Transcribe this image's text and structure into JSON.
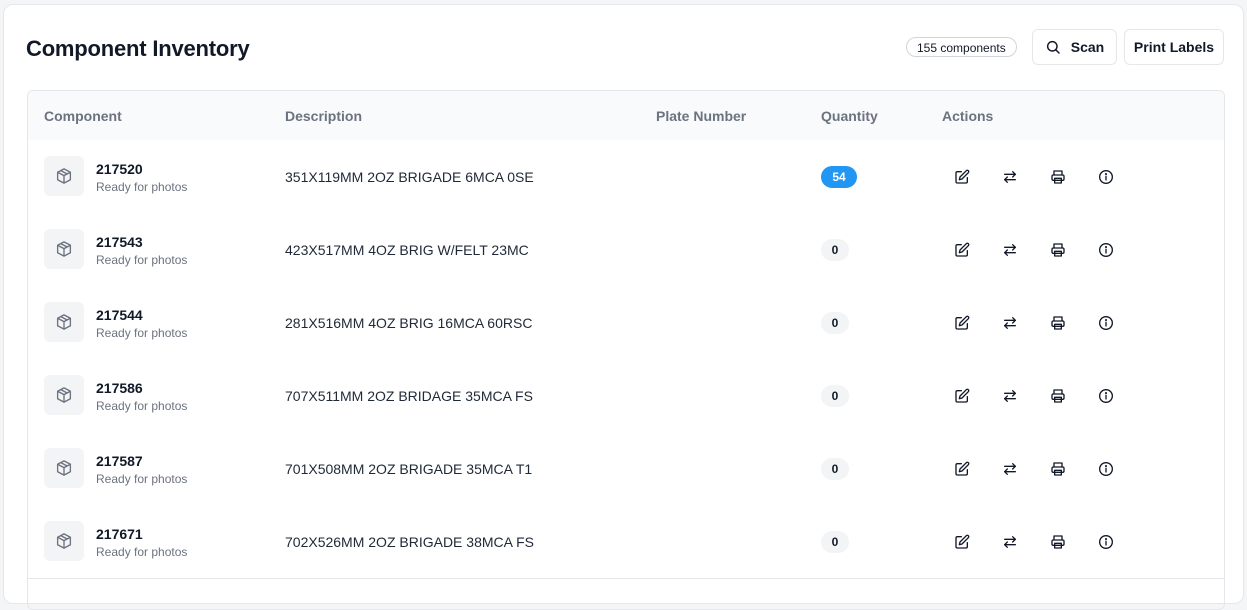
{
  "header": {
    "title": "Component Inventory",
    "count_label": "155 components",
    "scan_label": "Scan",
    "print_labels_label": "Print Labels"
  },
  "table": {
    "columns": [
      "Component",
      "Description",
      "Plate Number",
      "Quantity",
      "Actions"
    ],
    "rows": [
      {
        "id": "217520",
        "status": "Ready for photos",
        "description": "351X119MM 2OZ BRIGADE 6MCA 0SE",
        "plate": "",
        "quantity": "54"
      },
      {
        "id": "217543",
        "status": "Ready for photos",
        "description": "423X517MM 4OZ BRIG W/FELT 23MC",
        "plate": "",
        "quantity": "0"
      },
      {
        "id": "217544",
        "status": "Ready for photos",
        "description": "281X516MM 4OZ BRIG 16MCA 60RSC",
        "plate": "",
        "quantity": "0"
      },
      {
        "id": "217586",
        "status": "Ready for photos",
        "description": "707X511MM 2OZ BRIDAGE 35MCA FS",
        "plate": "",
        "quantity": "0"
      },
      {
        "id": "217587",
        "status": "Ready for photos",
        "description": "701X508MM 2OZ BRIGADE 35MCA T1",
        "plate": "",
        "quantity": "0"
      },
      {
        "id": "217671",
        "status": "Ready for photos",
        "description": "702X526MM 2OZ BRIGADE 38MCA FS",
        "plate": "",
        "quantity": "0"
      }
    ],
    "row_actions": [
      "edit-icon",
      "transfer-icon",
      "print-icon",
      "info-icon"
    ]
  },
  "colors": {
    "accent_badge": "#2196f3",
    "muted_text": "#6b7280",
    "border": "#e5e7eb"
  }
}
